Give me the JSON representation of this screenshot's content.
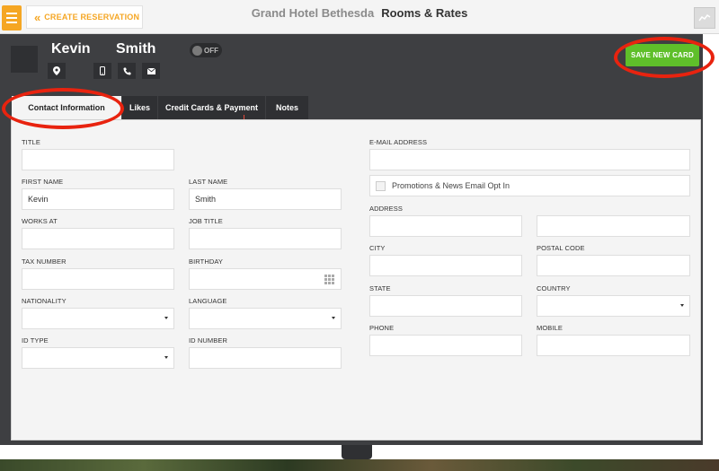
{
  "topbar": {
    "create_reservation": "CREATE RESERVATION",
    "hotel_name": "Grand Hotel Bethesda",
    "page_title": "Rooms & Rates"
  },
  "guest": {
    "first_name": "Kevin",
    "last_name": "Smith",
    "toggle_label": "OFF",
    "save_new_card": "SAVE NEW CARD"
  },
  "tabs": [
    {
      "label": "Contact Information",
      "active": true
    },
    {
      "label": "Likes",
      "active": false
    },
    {
      "label": "Credit Cards & Payment",
      "active": false
    },
    {
      "label": "Notes",
      "active": false
    }
  ],
  "form": {
    "title": {
      "label": "TITLE",
      "value": ""
    },
    "first_name": {
      "label": "FIRST NAME",
      "value": "Kevin"
    },
    "last_name": {
      "label": "LAST NAME",
      "value": "Smith"
    },
    "works_at": {
      "label": "WORKS AT",
      "value": ""
    },
    "job_title": {
      "label": "JOB TITLE",
      "value": ""
    },
    "tax_number": {
      "label": "TAX NUMBER",
      "value": ""
    },
    "birthday": {
      "label": "BIRTHDAY",
      "value": ""
    },
    "nationality": {
      "label": "NATIONALITY",
      "value": ""
    },
    "language": {
      "label": "LANGUAGE",
      "value": ""
    },
    "id_type": {
      "label": "ID TYPE",
      "value": ""
    },
    "id_number": {
      "label": "ID NUMBER",
      "value": ""
    },
    "email": {
      "label": "E-MAIL ADDRESS",
      "value": ""
    },
    "promotions_optin": "Promotions & News Email Opt In",
    "address": {
      "label": "ADDRESS",
      "value": "",
      "value2": ""
    },
    "city": {
      "label": "CITY",
      "value": ""
    },
    "postal_code": {
      "label": "POSTAL CODE",
      "value": ""
    },
    "state": {
      "label": "STATE",
      "value": ""
    },
    "country": {
      "label": "COUNTRY",
      "value": ""
    },
    "phone": {
      "label": "PHONE",
      "value": ""
    },
    "mobile": {
      "label": "MOBILE",
      "value": ""
    }
  },
  "colors": {
    "accent": "#f5a623",
    "save_button": "#5fbf2a",
    "header_bg": "#3e3f42",
    "annotation": "#e8230f"
  },
  "icons": [
    "menu-icon",
    "double-chevron-left-icon",
    "chart-icon",
    "location-pin-icon",
    "mobile-icon",
    "phone-icon",
    "email-icon",
    "calendar-icon",
    "dropdown-caret-icon"
  ]
}
